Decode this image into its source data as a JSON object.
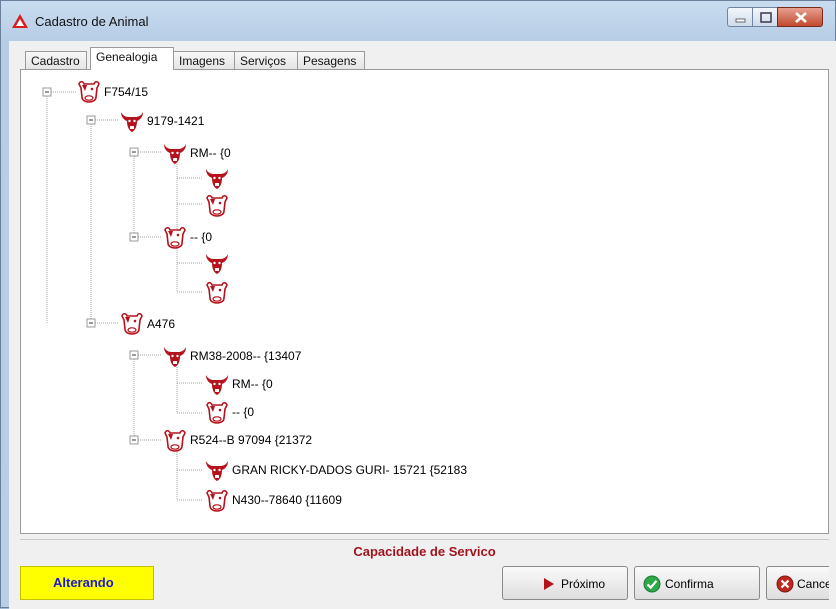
{
  "window": {
    "title": "Cadastro de Animal",
    "controls": [
      "minimize",
      "maximize",
      "close"
    ]
  },
  "tabs": [
    {
      "label": "Cadastro",
      "active": false
    },
    {
      "label": "Genealogia",
      "active": true
    },
    {
      "label": "Imagens",
      "active": false
    },
    {
      "label": "Serviços",
      "active": false
    },
    {
      "label": "Pesagens",
      "active": false
    }
  ],
  "tree": {
    "root": "F754/15",
    "sire": "9179-1421",
    "sire_sire": "RM-- {0",
    "sire_dam": "-- {0",
    "dam": "A476",
    "dam_sire": "RM38-2008-- {13407",
    "dam_sire_sire": "RM-- {0",
    "dam_sire_dam": "-- {0",
    "dam_dam": "R524--B 97094 {21372",
    "dam_dam_sire": "GRAN RICKY-DADOS GURI- 15721 {52183",
    "dam_dam_dam": "N430--78640 {11609"
  },
  "capacity_label": "Capacidade de Servico",
  "status_label": "Alterando",
  "buttons": {
    "next": "Próximo",
    "confirm": "Confirma",
    "cancel": "Cance"
  },
  "icons": {
    "bull": "bull-head-icon",
    "cow": "cow-head-icon",
    "collapse": "tree-collapse-icon"
  },
  "colors": {
    "icon_red": "#b5121b",
    "capacity_text": "#a0141e",
    "status_bg": "#ffff00",
    "status_text": "#1a1ad0"
  }
}
